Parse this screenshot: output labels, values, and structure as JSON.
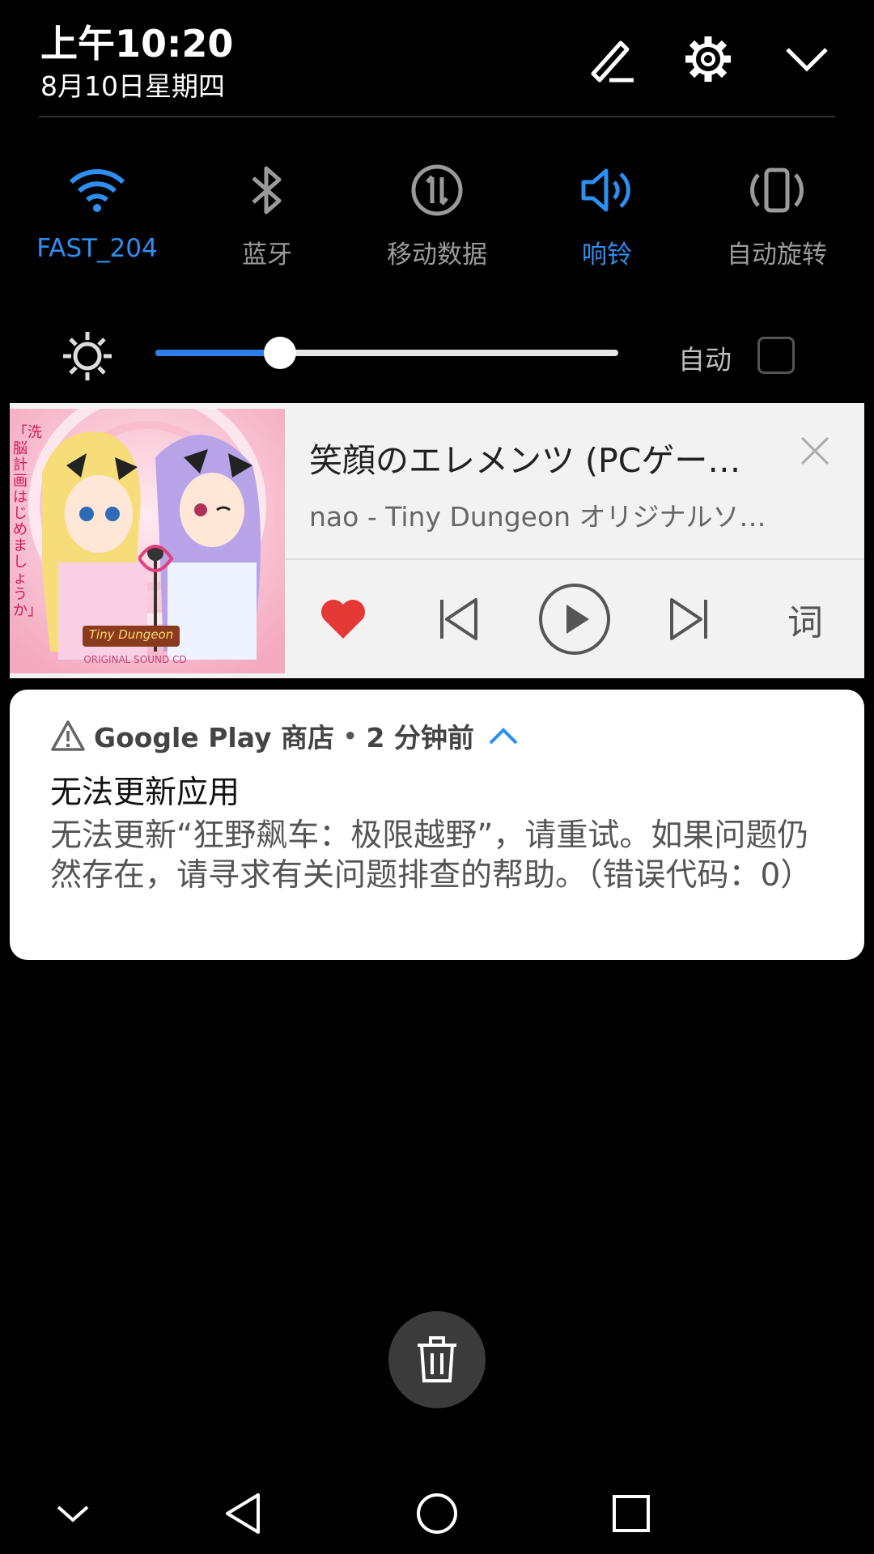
{
  "header": {
    "time": "上午10:20",
    "date": "8月10日星期四"
  },
  "quick_settings": [
    {
      "label": "FAST_204",
      "icon": "wifi-icon",
      "active": true
    },
    {
      "label": "蓝牙",
      "icon": "bluetooth-icon",
      "active": false
    },
    {
      "label": "移动数据",
      "icon": "mobile-data-icon",
      "active": false
    },
    {
      "label": "响铃",
      "icon": "speaker-icon",
      "active": true
    },
    {
      "label": "自动旋转",
      "icon": "auto-rotate-icon",
      "active": false
    }
  ],
  "brightness": {
    "level": 0.27,
    "auto_label": "自动",
    "auto_checked": false
  },
  "music": {
    "title": "笑顔のエレメンツ (PCゲー…",
    "subtitle": "nao - Tiny Dungeon オリジナルソ…",
    "lyrics_label": "词",
    "favorited": true,
    "album_art_text": "「洗脳計画はじめましょうか」",
    "album_logo_text": "Tiny Dungeon",
    "album_caption": "ORIGINAL SOUND CD"
  },
  "notification": {
    "app": "Google Play 商店",
    "separator": "•",
    "time_ago": "2 分钟前",
    "title": "无法更新应用",
    "body": "无法更新“狂野飙车：极限越野”，请重试。如果问题仍然存在，请寻求有关问题排查的帮助。（错误代码：0）"
  },
  "colors": {
    "accent": "#2E8FF2",
    "inactive": "#9A9A9A",
    "heart": "#E53935",
    "background": "#000000"
  }
}
